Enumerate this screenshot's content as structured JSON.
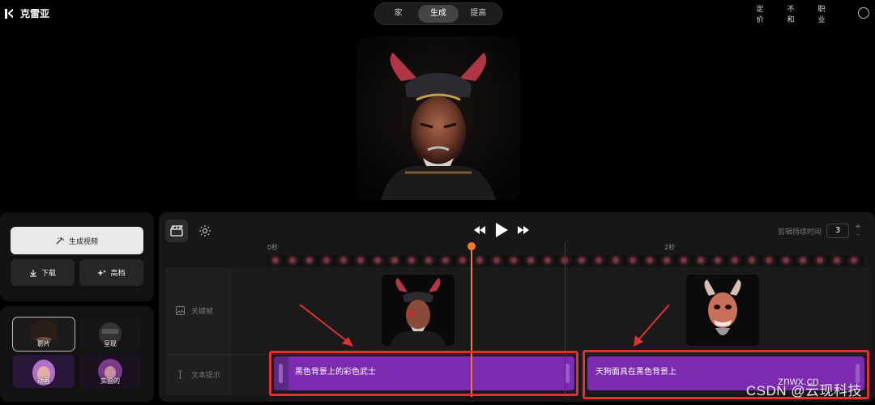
{
  "app": {
    "title": "克雷亚"
  },
  "nav": {
    "items": [
      {
        "label": "家"
      },
      {
        "label": "生成"
      },
      {
        "label": "提高"
      }
    ],
    "active_index": 1
  },
  "top_right": {
    "pricing": "定价",
    "other": "不和",
    "jobs": "职业"
  },
  "left_panel": {
    "generate_video": "生成视频",
    "download": "下载",
    "upscale": "高档",
    "styles": [
      {
        "label": "影片",
        "selected": true
      },
      {
        "label": "呈现",
        "selected": false
      },
      {
        "label": "动画",
        "selected": false
      },
      {
        "label": "实验的",
        "selected": false
      }
    ]
  },
  "timeline": {
    "trim_label": "剪辑持续时间",
    "trim_value": "3",
    "stepper_up": "+",
    "stepper_down": "-",
    "ruler": {
      "start": "0秒",
      "mid": "2秒"
    },
    "rows": {
      "keyframes": "关键帧",
      "text_prompt": "文本提示"
    },
    "clips": [
      {
        "text": "黑色背景上的彩色武士"
      },
      {
        "text": "天狗面具在黑色背景上"
      }
    ]
  },
  "watermark": "CSDN @云现科技",
  "watermark_overlay": "znwx.cn",
  "colors": {
    "clip": "#7a2bb0",
    "playhead": "#f07a2a",
    "highlight": "#e03030"
  }
}
